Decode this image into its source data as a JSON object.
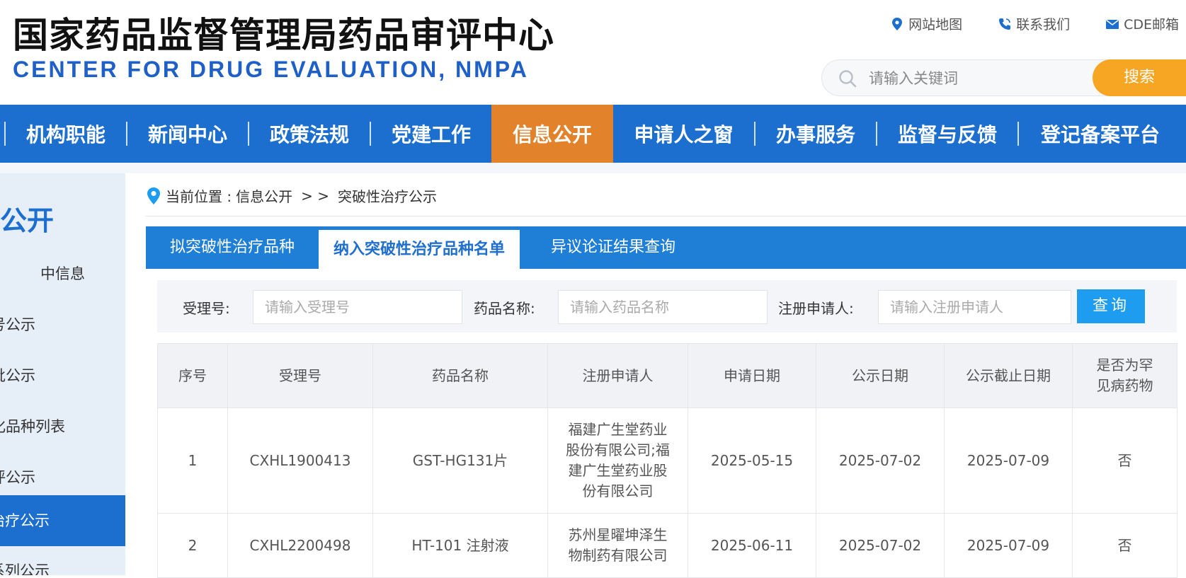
{
  "header": {
    "title_cn": "国家药品监督管理局药品审评中心",
    "title_en": "CENTER FOR DRUG EVALUATION, NMPA",
    "links": [
      "网站地图",
      "联系我们",
      "CDE邮箱"
    ],
    "search_placeholder": "请输入关键词",
    "search_button": "搜索"
  },
  "nav": {
    "items": [
      "机构职能",
      "新闻中心",
      "政策法规",
      "党建工作",
      "信息公开",
      "申请人之窗",
      "办事服务",
      "监督与反馈",
      "登记备案平台"
    ],
    "active": "信息公开"
  },
  "sidebar": {
    "title": "公开",
    "items": [
      "中信息",
      "号公示",
      "批公示",
      "化品种列表",
      "评公示",
      "治疗公示",
      "系列公示"
    ],
    "active_index": 5
  },
  "breadcrumb": {
    "prefix": "当前位置 : ",
    "section": "信息公开",
    "separator": "> >",
    "current": "突破性治疗公示"
  },
  "tabs": [
    "拟突破性治疗品种",
    "纳入突破性治疗品种名单",
    "异议论证结果查询"
  ],
  "active_tab": 1,
  "filters": {
    "accept_label": "受理号:",
    "accept_placeholder": "请输入受理号",
    "drug_label": "药品名称:",
    "drug_placeholder": "请输入药品名称",
    "applicant_label": "注册申请人:",
    "applicant_placeholder": "请输入注册申请人",
    "query_button": "查询"
  },
  "table": {
    "headers": [
      "序号",
      "受理号",
      "药品名称",
      "注册申请人",
      "申请日期",
      "公示日期",
      "公示截止日期",
      "是否为罕见病药物"
    ],
    "rows": [
      [
        "1",
        "CXHL1900413",
        "GST-HG131片",
        "福建广生堂药业股份有限公司;福建广生堂药业股份有限公司",
        "2025-05-15",
        "2025-07-02",
        "2025-07-09",
        "否"
      ],
      [
        "2",
        "CXHL2200498",
        "HT-101 注射液",
        "苏州星曜坤泽生物制药有限公司",
        "2025-06-11",
        "2025-07-02",
        "2025-07-09",
        "否"
      ]
    ]
  },
  "colors": {
    "nav_blue": "#1d6fcf",
    "nav_active": "#e2822a",
    "search_button": "#f6a623",
    "query_button": "#1d9cf0",
    "tab_bar": "#1f7fd6"
  }
}
